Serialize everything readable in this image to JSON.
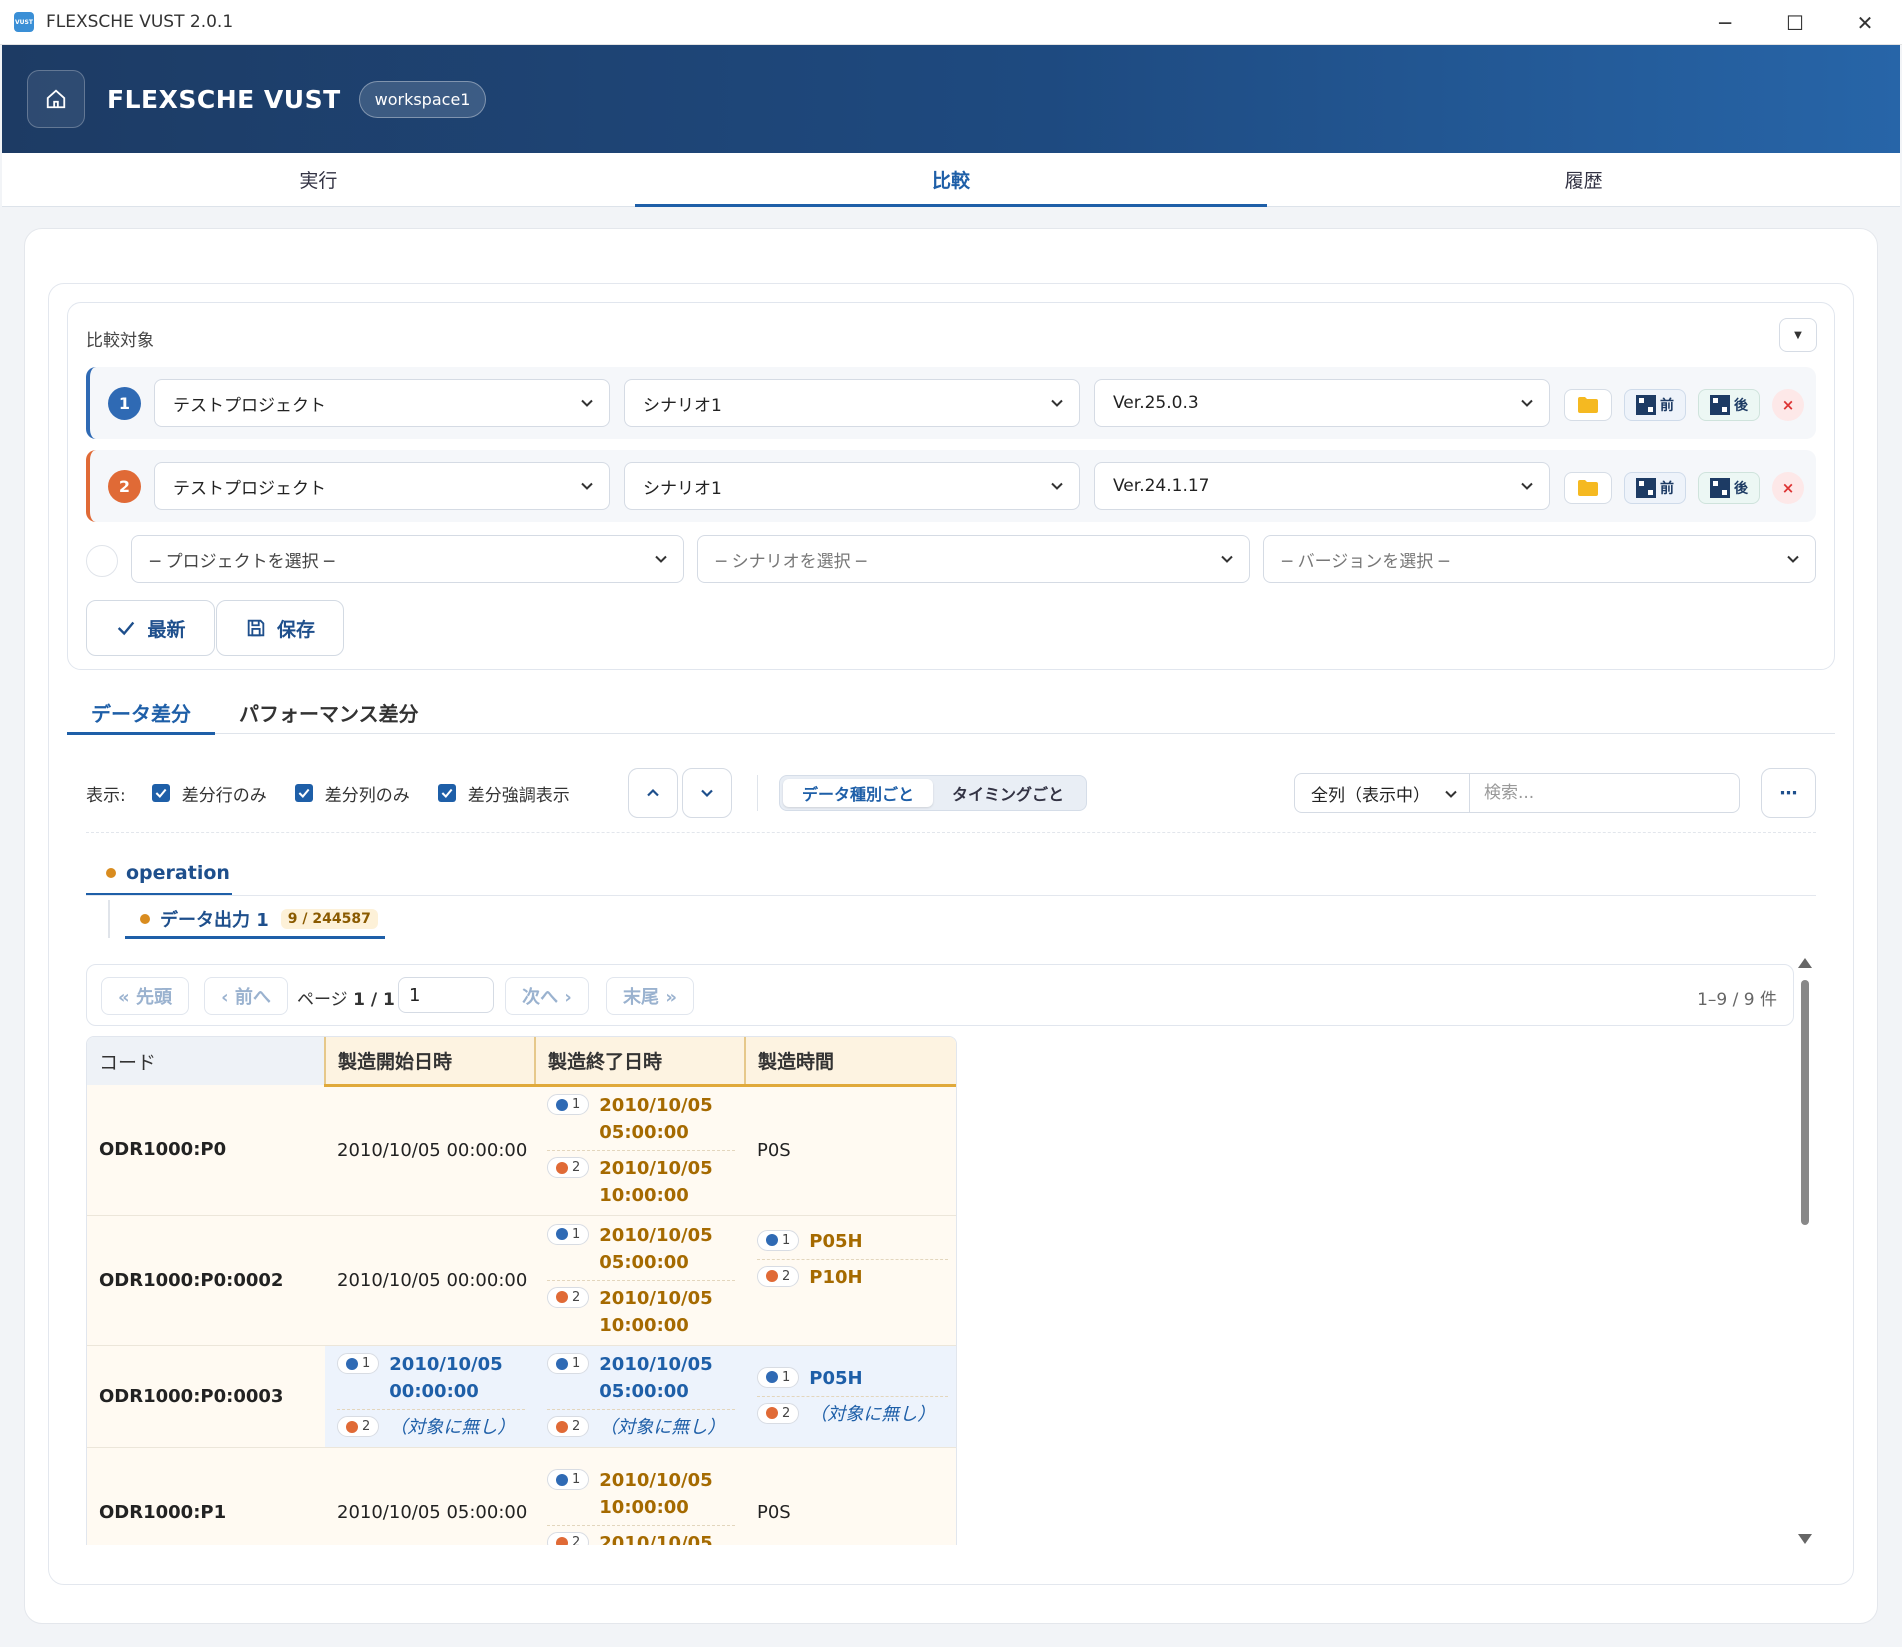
{
  "window": {
    "title": "FLEXSCHE VUST 2.0.1",
    "icon_text": "VUST",
    "minimize": "─",
    "maximize": "☐",
    "close": "✕"
  },
  "header": {
    "brand": "FLEXSCHE VUST",
    "workspace": "workspace1"
  },
  "main_tabs": [
    {
      "label": "実行",
      "active": false
    },
    {
      "label": "比較",
      "active": true
    },
    {
      "label": "履歴",
      "active": false
    }
  ],
  "compare": {
    "title": "比較対象",
    "rows": [
      {
        "num": "1",
        "project": "テストプロジェクト",
        "scenario": "シナリオ1",
        "version": "Ver.25.0.3",
        "pre_label": "前",
        "post_label": "後",
        "remove": "×"
      },
      {
        "num": "2",
        "project": "テストプロジェクト",
        "scenario": "シナリオ1",
        "version": "Ver.24.1.17",
        "pre_label": "前",
        "post_label": "後",
        "remove": "×"
      }
    ],
    "new_row": {
      "project_placeholder": "─ プロジェクトを選択 ─",
      "scenario_placeholder": "─ シナリオを選択 ─",
      "version_placeholder": "─ バージョンを選択 ─"
    },
    "refresh_label": "最新",
    "save_label": "保存"
  },
  "sub_tabs": [
    {
      "label": "データ差分",
      "active": true
    },
    {
      "label": "パフォーマンス差分",
      "active": false
    }
  ],
  "toolbar": {
    "display_label": "表示:",
    "checks": [
      {
        "label": "差分行のみ",
        "checked": true
      },
      {
        "label": "差分列のみ",
        "checked": true
      },
      {
        "label": "差分強調表示",
        "checked": true
      }
    ],
    "segments": [
      {
        "label": "データ種別ごと",
        "active": true
      },
      {
        "label": "タイミングごと",
        "active": false
      }
    ],
    "column_select": "全列（表示中）",
    "search_placeholder": "検索...",
    "more": "⋯"
  },
  "tree": {
    "level1": "operation",
    "level2": "データ出力 1",
    "level2_count": "9 / 244587"
  },
  "pager": {
    "first": "« 先頭",
    "prev": "‹ 前へ",
    "page_prefix": "ページ",
    "page_value": "1 / 1",
    "page_input": "1",
    "next": "次へ ›",
    "last": "末尾 »",
    "count": "1–9 / 9 件"
  },
  "table": {
    "columns": [
      "コード",
      "製造開始日時",
      "製造終了日時",
      "製造時間"
    ],
    "rows": [
      {
        "code": "ODR1000:P0",
        "start": "2010/10/05 00:00:00",
        "end1": "2010/10/05 05:00:00",
        "end2": "2010/10/05 10:00:00",
        "time": "P0S"
      },
      {
        "code": "ODR1000:P0:0002",
        "start": "2010/10/05 00:00:00",
        "end1": "2010/10/05 05:00:00",
        "end2": "2010/10/05 10:00:00",
        "time1": "P05H",
        "time2": "P10H"
      },
      {
        "code": "ODR1000:P0:0003",
        "start1": "2010/10/05 00:00:00",
        "start2": "（対象に無し）",
        "end1": "2010/10/05 05:00:00",
        "end2": "（対象に無し）",
        "time1": "P05H",
        "time2": "（対象に無し）"
      },
      {
        "code": "ODR1000:P1",
        "start": "2010/10/05 05:00:00",
        "end1": "2010/10/05 10:00:00",
        "end2": "2010/10/05",
        "time": "P0S"
      }
    ],
    "pill1": "1",
    "pill2": "2"
  },
  "colors": {
    "header_dark": "#1d3b64",
    "accent_blue": "#1e5fa8",
    "target1": "#2f6ab4",
    "target2": "#e06a36",
    "diff_text": "#a56a00"
  }
}
